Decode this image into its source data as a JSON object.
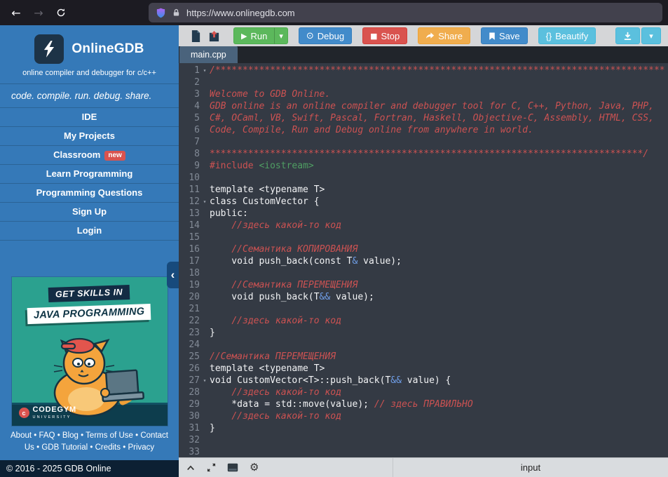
{
  "browser": {
    "url": "https://www.onlinegdb.com"
  },
  "icons": {
    "back": "←",
    "forward": "→",
    "play": "▶",
    "caret_down": "▾",
    "debug": "⊙",
    "stop": "■",
    "chevron_left": "‹",
    "gear": "⚙",
    "fold": "▾",
    "bullet": "•",
    "bolt": "⚡"
  },
  "sidebar": {
    "logo": {
      "title": "OnlineGDB",
      "subtitle": "online compiler and debugger for c/c++"
    },
    "tagline": "code. compile. run. debug. share.",
    "menu": [
      {
        "label": "IDE"
      },
      {
        "label": "My Projects"
      },
      {
        "label": "Classroom",
        "badge": "new"
      },
      {
        "label": "Learn Programming"
      },
      {
        "label": "Programming Questions"
      },
      {
        "label": "Sign Up"
      },
      {
        "label": "Login"
      }
    ],
    "ad": {
      "line1": "GET SKILLS IN",
      "line2": "JAVA PROGRAMMING",
      "brand": "CODEGYM",
      "brand_sub": "UNIVERSITY"
    },
    "footer_links": [
      "About",
      "FAQ",
      "Blog",
      "Terms of Use",
      "Contact Us",
      "GDB Tutorial",
      "Credits",
      "Privacy"
    ],
    "copyright": "© 2016 - 2025 GDB Online"
  },
  "toolbar": {
    "run_label": "Run",
    "debug_label": "Debug",
    "stop_label": "Stop",
    "share_label": "Share",
    "save_label": "Save",
    "beautify_icon": "{}",
    "beautify_label": "Beautify"
  },
  "tabs": [
    {
      "label": "main.cpp"
    }
  ],
  "editor": {
    "fold_markers": [
      1,
      12,
      27
    ],
    "lines": [
      [
        [
          "c",
          "/**********************************************************************************"
        ]
      ],
      [],
      [
        [
          "c",
          "Welcome to GDB Online."
        ]
      ],
      [
        [
          "c",
          "GDB online is an online compiler and debugger tool for C, C++, Python, Java, PHP,"
        ]
      ],
      [
        [
          "c",
          "C#, OCaml, VB, Swift, Pascal, Fortran, Haskell, Objective-C, Assembly, HTML, CSS,"
        ]
      ],
      [
        [
          "c",
          "Code, Compile, Run and Debug online from anywhere in world."
        ]
      ],
      [],
      [
        [
          "c",
          "*******************************************************************************/"
        ]
      ],
      [
        [
          "pp",
          "#include"
        ],
        [
          "p",
          " "
        ],
        [
          "s",
          "<iostream>"
        ]
      ],
      [],
      [
        [
          "p",
          "template <typename T>"
        ]
      ],
      [
        [
          "p",
          "class CustomVector {"
        ]
      ],
      [
        [
          "p",
          "public:"
        ]
      ],
      [
        [
          "p",
          "    "
        ],
        [
          "c",
          "//здесь какой-то код"
        ]
      ],
      [],
      [
        [
          "p",
          "    "
        ],
        [
          "c",
          "//Семантика КОПИРОВАНИЯ"
        ]
      ],
      [
        [
          "p",
          "    void push_back(const T"
        ],
        [
          "o",
          "&"
        ],
        [
          "p",
          " value);"
        ]
      ],
      [],
      [
        [
          "p",
          "    "
        ],
        [
          "c",
          "//Семантика ПЕРЕМЕЩЕНИЯ"
        ]
      ],
      [
        [
          "p",
          "    void push_back(T"
        ],
        [
          "o",
          "&&"
        ],
        [
          "p",
          " value);"
        ]
      ],
      [],
      [
        [
          "p",
          "    "
        ],
        [
          "c",
          "//здесь какой-то код"
        ]
      ],
      [
        [
          "p",
          "}"
        ]
      ],
      [],
      [
        [
          "c",
          "//Семантика ПЕРЕМЕЩЕНИЯ"
        ]
      ],
      [
        [
          "p",
          "template <typename T>"
        ]
      ],
      [
        [
          "p",
          "void CustomVector<T>::push_back(T"
        ],
        [
          "o",
          "&&"
        ],
        [
          "p",
          " value) {"
        ]
      ],
      [
        [
          "p",
          "    "
        ],
        [
          "c",
          "//здесь какой-то код"
        ]
      ],
      [
        [
          "p",
          "    *data = std::move(value); "
        ],
        [
          "c",
          "// здесь ПРАВИЛЬНО"
        ]
      ],
      [
        [
          "p",
          "    "
        ],
        [
          "c",
          "//здесь какой-то код"
        ]
      ],
      [
        [
          "p",
          "}"
        ]
      ],
      [],
      []
    ]
  },
  "bottom": {
    "input_label": "input"
  },
  "colors": {
    "sidebar-blue": "#3579b8",
    "accent-red": "#d9534f",
    "run-green": "#5cb85c",
    "primary-blue": "#428bca",
    "stop-red": "#d9534f",
    "share-orange": "#f0ad4e",
    "beautify-cyan": "#5bc0de",
    "editor-bg": "#343a44",
    "comment-red": "#cc5252",
    "include-green": "#4f9e63",
    "operator-blue": "#6f9ee8",
    "ad-teal": "#2ba18f",
    "tab-active": "#4a637c"
  }
}
